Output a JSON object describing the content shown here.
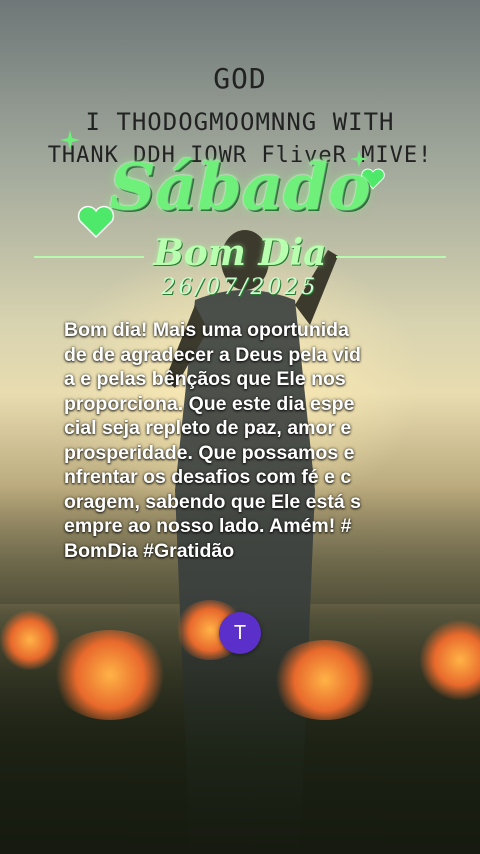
{
  "header": {
    "god_text": "GOD",
    "sketch_line1": "I THODOGMOOMNNG WITH",
    "sketch_line2": "THANK   DDH IOWR FliveR MIVE!",
    "day": "Sábado",
    "greeting": "Bom Dia",
    "date": "26/07/2025"
  },
  "post": {
    "message": "Bom dia! Mais uma oportunida\nde de agradecer a Deus pela vid\na e pelas bênçãos que Ele nos\nproporciona. Que este dia espe\ncial seja repleto de paz, amor e\nprosperidade. Que possamos e\nnfrentar os desafios com fé e c\noragem, sabendo que Ele está s\nempre ao nosso lado. Amém! #\nBomDia #Gratidão"
  },
  "profile": {
    "avatar_initial": "T",
    "avatar_color": "#5b2fc9"
  },
  "colors": {
    "title_green": "#6ef07a",
    "greeting_green": "#b8ffb0"
  }
}
